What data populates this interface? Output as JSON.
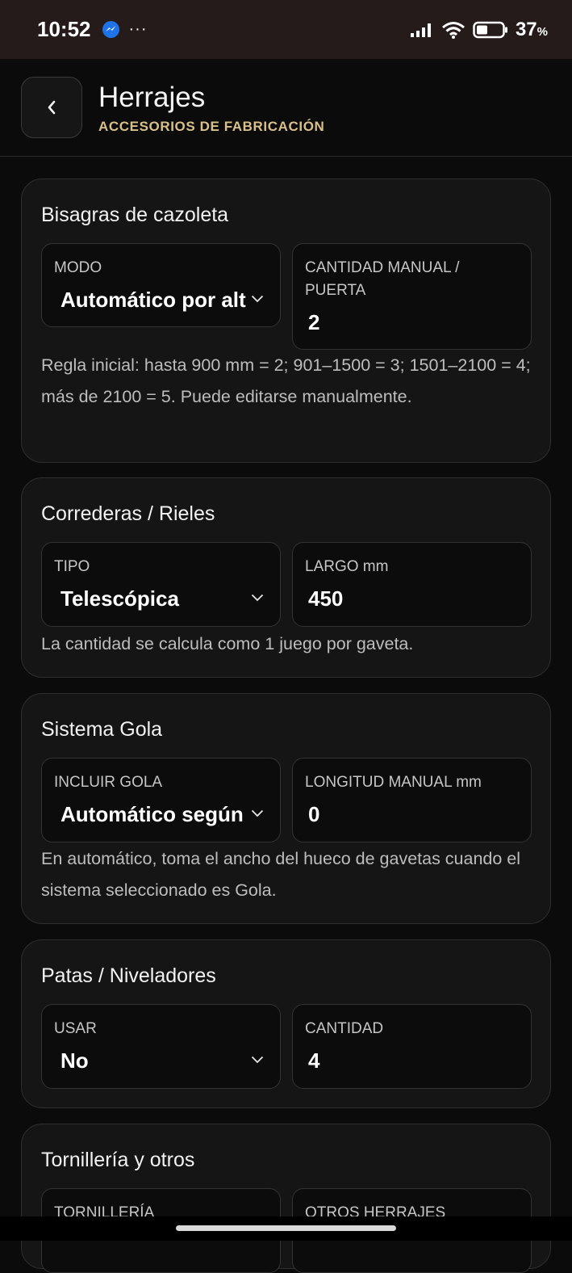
{
  "status": {
    "time": "10:52",
    "more": "···",
    "battery": "37",
    "battery_unit": "%"
  },
  "header": {
    "title": "Herrajes",
    "subtitle": "ACCESORIOS DE FABRICACIÓN"
  },
  "cards": [
    {
      "title": "Bisagras de cazoleta",
      "fields": [
        {
          "label": "MODO",
          "value": "Automático por altura",
          "type": "select"
        },
        {
          "label": "CANTIDAD MANUAL / PUERTA",
          "value": "2",
          "type": "input"
        }
      ],
      "note": "Regla inicial: hasta 900 mm = 2; 901–1500 = 3; 1501–2100 = 4; más de 2100 = 5. Puede editarse manualmente."
    },
    {
      "title": "Correderas / Rieles",
      "fields": [
        {
          "label": "TIPO",
          "value": "Telescópica",
          "type": "select"
        },
        {
          "label": "LARGO mm",
          "value": "450",
          "type": "input"
        }
      ],
      "note": "La cantidad se calcula como 1 juego por gaveta."
    },
    {
      "title": "Sistema Gola",
      "fields": [
        {
          "label": "INCLUIR GOLA",
          "value": "Automático según sistema",
          "type": "select"
        },
        {
          "label": "LONGITUD MANUAL mm",
          "value": "0",
          "type": "input"
        }
      ],
      "note": "En automático, toma el ancho del hueco de gavetas cuando el sistema seleccionado es Gola."
    },
    {
      "title": "Patas / Niveladores",
      "fields": [
        {
          "label": "USAR",
          "value": "No",
          "type": "select"
        },
        {
          "label": "CANTIDAD",
          "value": "4",
          "type": "input"
        }
      ]
    },
    {
      "title": "Tornillería y otros",
      "fields": [
        {
          "label": "TORNILLERÍA",
          "type": "input"
        },
        {
          "label": "OTROS HERRAJES",
          "type": "input"
        }
      ]
    }
  ]
}
